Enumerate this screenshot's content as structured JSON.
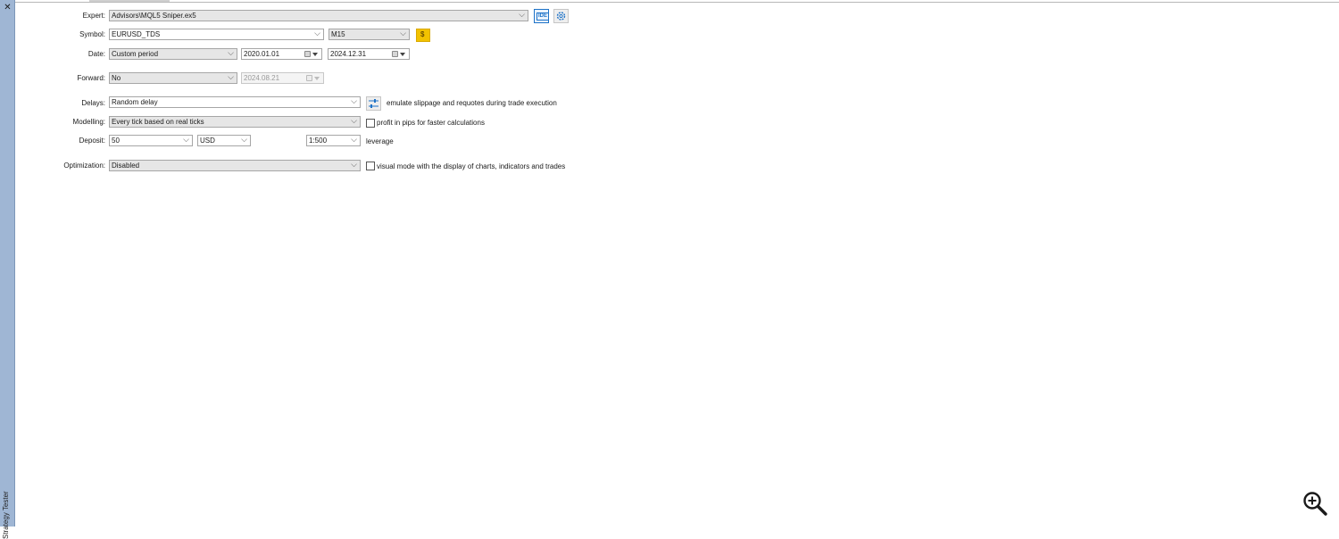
{
  "sidebar": {
    "title": "Strategy Tester",
    "close_icon": "close-icon"
  },
  "form": {
    "expert": {
      "label": "Expert:",
      "value": "Advisors\\MQL5 Sniper.ex5",
      "ide_label": "IDE"
    },
    "symbol": {
      "label": "Symbol:",
      "value": "EURUSD_TDS",
      "timeframe": "M15",
      "button_label": "$"
    },
    "date": {
      "label": "Date:",
      "period": "Custom period",
      "from": "2020.01.01",
      "to": "2024.12.31"
    },
    "forward": {
      "label": "Forward:",
      "value": "No",
      "date": "2024.08.21"
    },
    "delays": {
      "label": "Delays:",
      "value": "Random delay",
      "note": "emulate slippage and requotes during trade execution"
    },
    "modelling": {
      "label": "Modelling:",
      "value": "Every tick based on real ticks",
      "checkbox_label": "profit in pips for faster calculations",
      "checked": false
    },
    "deposit": {
      "label": "Deposit:",
      "amount": "50",
      "currency": "USD",
      "leverage": "1:500",
      "leverage_label": "leverage"
    },
    "optimization": {
      "label": "Optimization:",
      "value": "Disabled",
      "checkbox_label": "visual mode with the display of charts, indicators and trades",
      "checked": false
    }
  },
  "colors": {
    "sidebar": "#9fb6d4",
    "accent_blue": "#1e73c8",
    "symbol_button": "#f2c200"
  }
}
